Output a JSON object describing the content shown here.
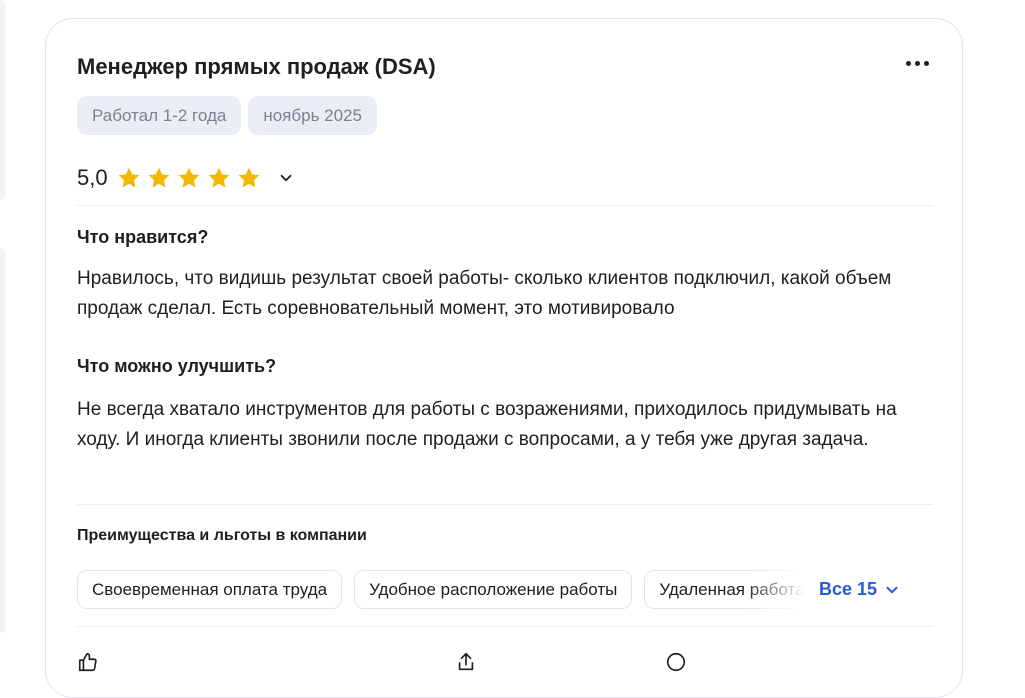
{
  "review": {
    "title": "Менеджер прямых продаж (DSA)",
    "tags": [
      "Работал 1-2 года",
      "ноябрь 2025"
    ],
    "rating": {
      "value": "5,0",
      "stars": 5,
      "star_color": "#f5b800"
    },
    "likes": {
      "heading": "Что нравится?",
      "text": "Нравилось, что видишь результат своей работы- сколько клиентов подключил, какой объем продаж сделал. Есть соревновательный момент, это мотивировало"
    },
    "improve": {
      "heading": "Что можно улучшить?",
      "text": "Не всегда хватало инструментов для работы с возражениями, приходилось придумывать на ходу. И иногда клиенты звонили после продажи с вопросами, а у тебя уже другая задача."
    },
    "benefits": {
      "heading": "Преимущества и льготы в компании",
      "items": [
        "Своевременная оплата труда",
        "Удобное расположение работы",
        "Удаленная работа"
      ],
      "show_all_label": "Все 15"
    }
  },
  "colors": {
    "accent": "#2a5ad6",
    "tag_bg": "#e9eef6",
    "tag_text": "#7b8190",
    "border": "#e3e5e8"
  },
  "icons": {
    "more": "more-horizontal-icon",
    "star": "star-icon",
    "chevron": "chevron-down-icon",
    "like": "thumbs-up-icon",
    "share": "share-icon",
    "comment": "comment-icon"
  }
}
